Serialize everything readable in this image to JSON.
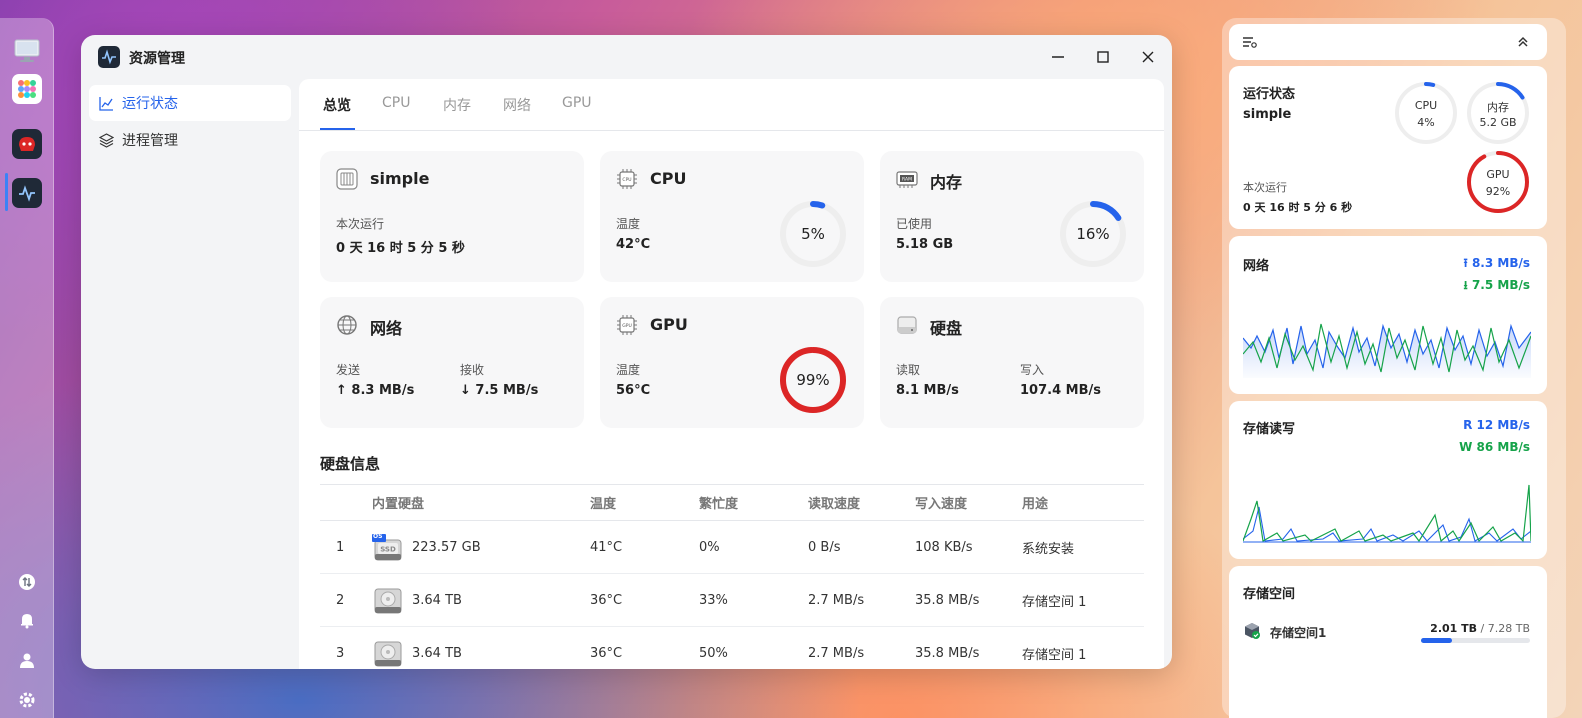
{
  "window": {
    "title": "资源管理",
    "sidebar": [
      {
        "label": "运行状态",
        "icon": "chart-line-icon",
        "active": true
      },
      {
        "label": "进程管理",
        "icon": "layers-icon",
        "active": false
      }
    ],
    "tabs": [
      {
        "label": "总览",
        "active": true
      },
      {
        "label": "CPU",
        "active": false
      },
      {
        "label": "内存",
        "active": false
      },
      {
        "label": "网络",
        "active": false
      },
      {
        "label": "GPU",
        "active": false
      }
    ]
  },
  "cards": {
    "system": {
      "title": "simple",
      "label": "本次运行",
      "value": "0 天 16 时 5 分 5 秒"
    },
    "cpu": {
      "title": "CPU",
      "label": "温度",
      "value": "42°C",
      "usage_text": "5%",
      "usage": 0.05
    },
    "memory": {
      "title": "内存",
      "label": "已使用",
      "value": "5.18 GB",
      "usage_text": "16%",
      "usage": 0.16
    },
    "network": {
      "title": "网络",
      "send_label": "发送",
      "send_value": "↑ 8.3 MB/s",
      "recv_label": "接收",
      "recv_value": "↓ 7.5 MB/s"
    },
    "gpu": {
      "title": "GPU",
      "label": "温度",
      "value": "56°C",
      "usage_text": "99%",
      "usage": 0.99
    },
    "disk": {
      "title": "硬盘",
      "read_label": "读取",
      "read_value": "8.1 MB/s",
      "write_label": "写入",
      "write_value": "107.4 MB/s"
    }
  },
  "disk_info": {
    "title": "硬盘信息",
    "headers": [
      "",
      "内置硬盘",
      "温度",
      "繁忙度",
      "读取速度",
      "写入速度",
      "用途"
    ],
    "rows": [
      {
        "index": "1",
        "badge": "OS",
        "type": "SSD",
        "capacity": "223.57 GB",
        "temp": "41°C",
        "busy": "0%",
        "read": "0 B/s",
        "write": "108 KB/s",
        "usage": "系统安装"
      },
      {
        "index": "2",
        "badge": "",
        "type": "HDD",
        "capacity": "3.64 TB",
        "temp": "36°C",
        "busy": "33%",
        "read": "2.7 MB/s",
        "write": "35.8 MB/s",
        "usage": "存储空间 1"
      },
      {
        "index": "3",
        "badge": "",
        "type": "HDD",
        "capacity": "3.64 TB",
        "temp": "36°C",
        "busy": "50%",
        "read": "2.7 MB/s",
        "write": "35.8 MB/s",
        "usage": "存储空间 1"
      }
    ]
  },
  "widgets": {
    "status": {
      "title": "运行状态",
      "host": "simple",
      "uptime_label": "本次运行",
      "uptime": "0 天 16 时 5 分 6 秒",
      "cpu": {
        "label": "CPU",
        "value": "4%",
        "usage": 0.04
      },
      "mem": {
        "label": "内存",
        "value": "5.2 GB",
        "usage": 0.16
      },
      "gpu": {
        "label": "GPU",
        "value": "92%",
        "usage": 0.92
      }
    },
    "network": {
      "title": "网络",
      "up": "8.3 MB/s",
      "down": "7.5 MB/s"
    },
    "storage_io": {
      "title": "存储读写",
      "read": "R  12 MB/s",
      "write": "W  86 MB/s"
    },
    "storage": {
      "title": "存储空间",
      "name": "存储空间1",
      "used": "2.01 TB",
      "total": "/ 7.28 TB",
      "usage": 0.28
    }
  },
  "colors": {
    "accent": "#2563eb",
    "danger": "#dc2626",
    "green": "#16a34a",
    "ring_track": "#eeeeee"
  }
}
